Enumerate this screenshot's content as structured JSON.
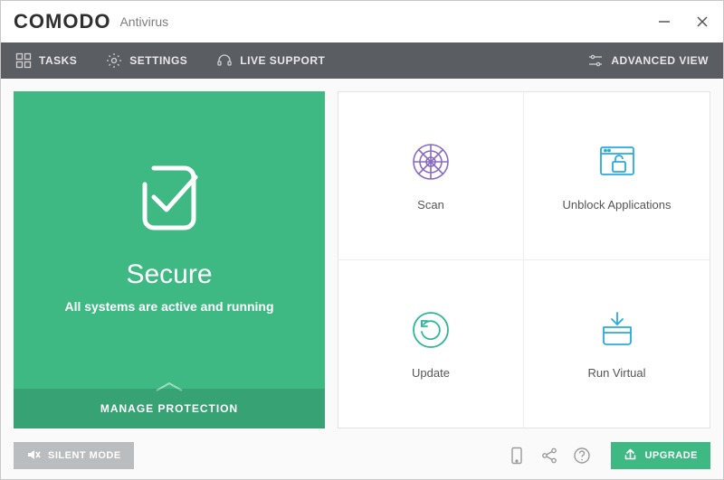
{
  "brand": {
    "name": "COMODO",
    "product": "Antivirus"
  },
  "toolbar": {
    "tasks": "TASKS",
    "settings": "SETTINGS",
    "live_support": "LIVE SUPPORT",
    "advanced_view": "ADVANCED VIEW"
  },
  "status": {
    "title": "Secure",
    "subtitle": "All systems are active and running",
    "manage": "MANAGE PROTECTION"
  },
  "tiles": {
    "scan": "Scan",
    "unblock": "Unblock Applications",
    "update": "Update",
    "run_virtual": "Run Virtual"
  },
  "footer": {
    "silent_mode": "SILENT MODE",
    "upgrade": "UPGRADE"
  },
  "colors": {
    "accent_green": "#3fb984",
    "toolbar_bg": "#5a5e63",
    "tile_blue": "#2aa9e0",
    "tile_purple": "#8a6bc4",
    "tile_teal": "#2fb79b"
  }
}
